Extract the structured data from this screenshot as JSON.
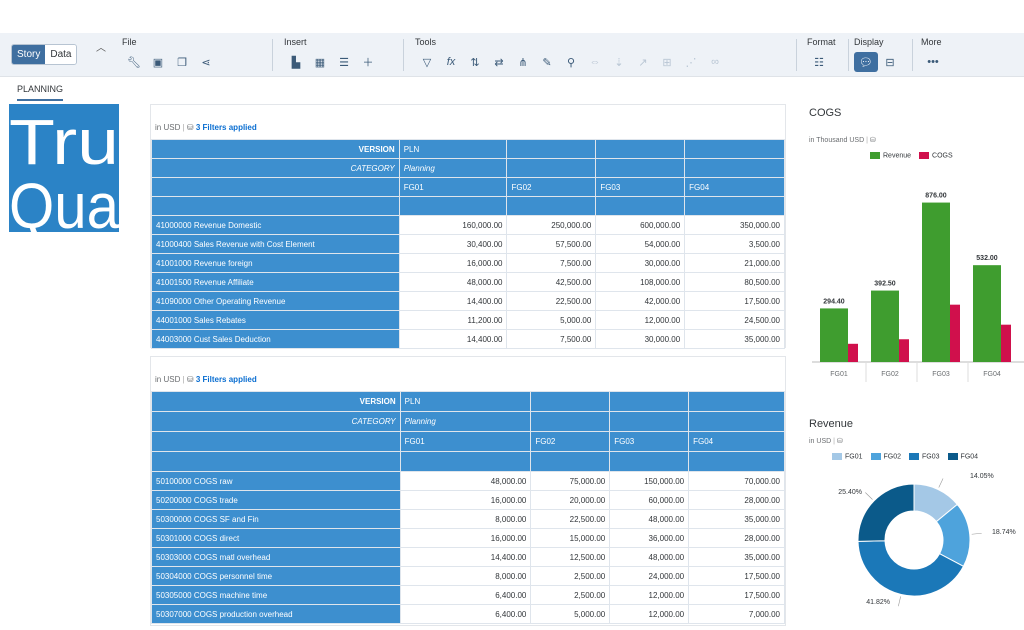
{
  "toolbar": {
    "story_label": "Story",
    "data_label": "Data",
    "groups": [
      {
        "label": "File"
      },
      {
        "label": "Insert"
      },
      {
        "label": "Tools"
      },
      {
        "label": "Format"
      },
      {
        "label": "Display"
      },
      {
        "label": "More"
      }
    ]
  },
  "tabs": [
    {
      "label": "PLANNING"
    }
  ],
  "logo": {
    "line1": "Tru",
    "line2": "Qua",
    "color": "#2b83c6"
  },
  "table1": {
    "unit": "in USD",
    "filters": "3 Filters applied",
    "version_label": "VERSION",
    "version_value": "PLN",
    "category_label": "CATEGORY",
    "category_value": "Planning",
    "columns": [
      "FG01",
      "FG02",
      "FG03",
      "FG04"
    ],
    "rows": [
      {
        "label": "41000000 Revenue Domestic",
        "values": [
          "160,000.00",
          "250,000.00",
          "600,000.00",
          "350,000.00"
        ]
      },
      {
        "label": "41000400 Sales Revenue with Cost Element",
        "values": [
          "30,400.00",
          "57,500.00",
          "54,000.00",
          "3,500.00"
        ]
      },
      {
        "label": "41001000 Revenue foreign",
        "values": [
          "16,000.00",
          "7,500.00",
          "30,000.00",
          "21,000.00"
        ]
      },
      {
        "label": "41001500 Revenue Affiliate",
        "values": [
          "48,000.00",
          "42,500.00",
          "108,000.00",
          "80,500.00"
        ]
      },
      {
        "label": "41090000 Other Operating Revenue",
        "values": [
          "14,400.00",
          "22,500.00",
          "42,000.00",
          "17,500.00"
        ]
      },
      {
        "label": "44001000 Sales Rebates",
        "values": [
          "11,200.00",
          "5,000.00",
          "12,000.00",
          "24,500.00"
        ]
      },
      {
        "label": "44003000 Cust Sales Deduction",
        "values": [
          "14,400.00",
          "7,500.00",
          "30,000.00",
          "35,000.00"
        ]
      }
    ]
  },
  "table2": {
    "unit": "in USD",
    "filters": "3 Filters applied",
    "version_label": "VERSION",
    "version_value": "PLN",
    "category_label": "CATEGORY",
    "category_value": "Planning",
    "columns": [
      "FG01",
      "FG02",
      "FG03",
      "FG04"
    ],
    "rows": [
      {
        "label": "50100000 COGS raw",
        "values": [
          "48,000.00",
          "75,000.00",
          "150,000.00",
          "70,000.00"
        ]
      },
      {
        "label": "50200000 COGS trade",
        "values": [
          "16,000.00",
          "20,000.00",
          "60,000.00",
          "28,000.00"
        ]
      },
      {
        "label": "50300000 COGS SF and Fin",
        "values": [
          "8,000.00",
          "22,500.00",
          "48,000.00",
          "35,000.00"
        ]
      },
      {
        "label": "50301000 COGS direct",
        "values": [
          "16,000.00",
          "15,000.00",
          "36,000.00",
          "28,000.00"
        ]
      },
      {
        "label": "50303000 COGS matl overhead",
        "values": [
          "14,400.00",
          "12,500.00",
          "48,000.00",
          "35,000.00"
        ]
      },
      {
        "label": "50304000 COGS personnel time",
        "values": [
          "8,000.00",
          "2,500.00",
          "24,000.00",
          "17,500.00"
        ]
      },
      {
        "label": "50305000 COGS machine time",
        "values": [
          "6,400.00",
          "2,500.00",
          "12,000.00",
          "17,500.00"
        ]
      },
      {
        "label": "50307000 COGS production overhead",
        "values": [
          "6,400.00",
          "5,000.00",
          "12,000.00",
          "7,000.00"
        ]
      }
    ]
  },
  "chart_data": [
    {
      "type": "bar",
      "title": "COGS",
      "subtitle": "in Thousand USD",
      "categories": [
        "FG01",
        "FG02",
        "FG03",
        "FG04"
      ],
      "series": [
        {
          "name": "Revenue",
          "values": [
            294.4,
            392.5,
            876.0,
            532.0
          ],
          "labels": [
            "294.40",
            "392.50",
            "876.00",
            "532.00"
          ],
          "color": "#3f9d2f"
        },
        {
          "name": "COGS",
          "values": [
            100,
            125,
            315,
            205
          ],
          "color": "#d0104c"
        }
      ],
      "ylim": [
        0,
        1000
      ],
      "legend": "top"
    },
    {
      "type": "pie",
      "title": "Revenue",
      "subtitle": "in USD",
      "categories": [
        "FG01",
        "FG02",
        "FG03",
        "FG04"
      ],
      "values": [
        14.05,
        18.74,
        41.82,
        25.4
      ],
      "labels": [
        "14.05%",
        "18.74%",
        "41.82%",
        "25.40%"
      ],
      "colors": [
        "#a4c8e6",
        "#4ea3dc",
        "#1b78b8",
        "#0b5a8a"
      ],
      "legend": "top"
    }
  ]
}
